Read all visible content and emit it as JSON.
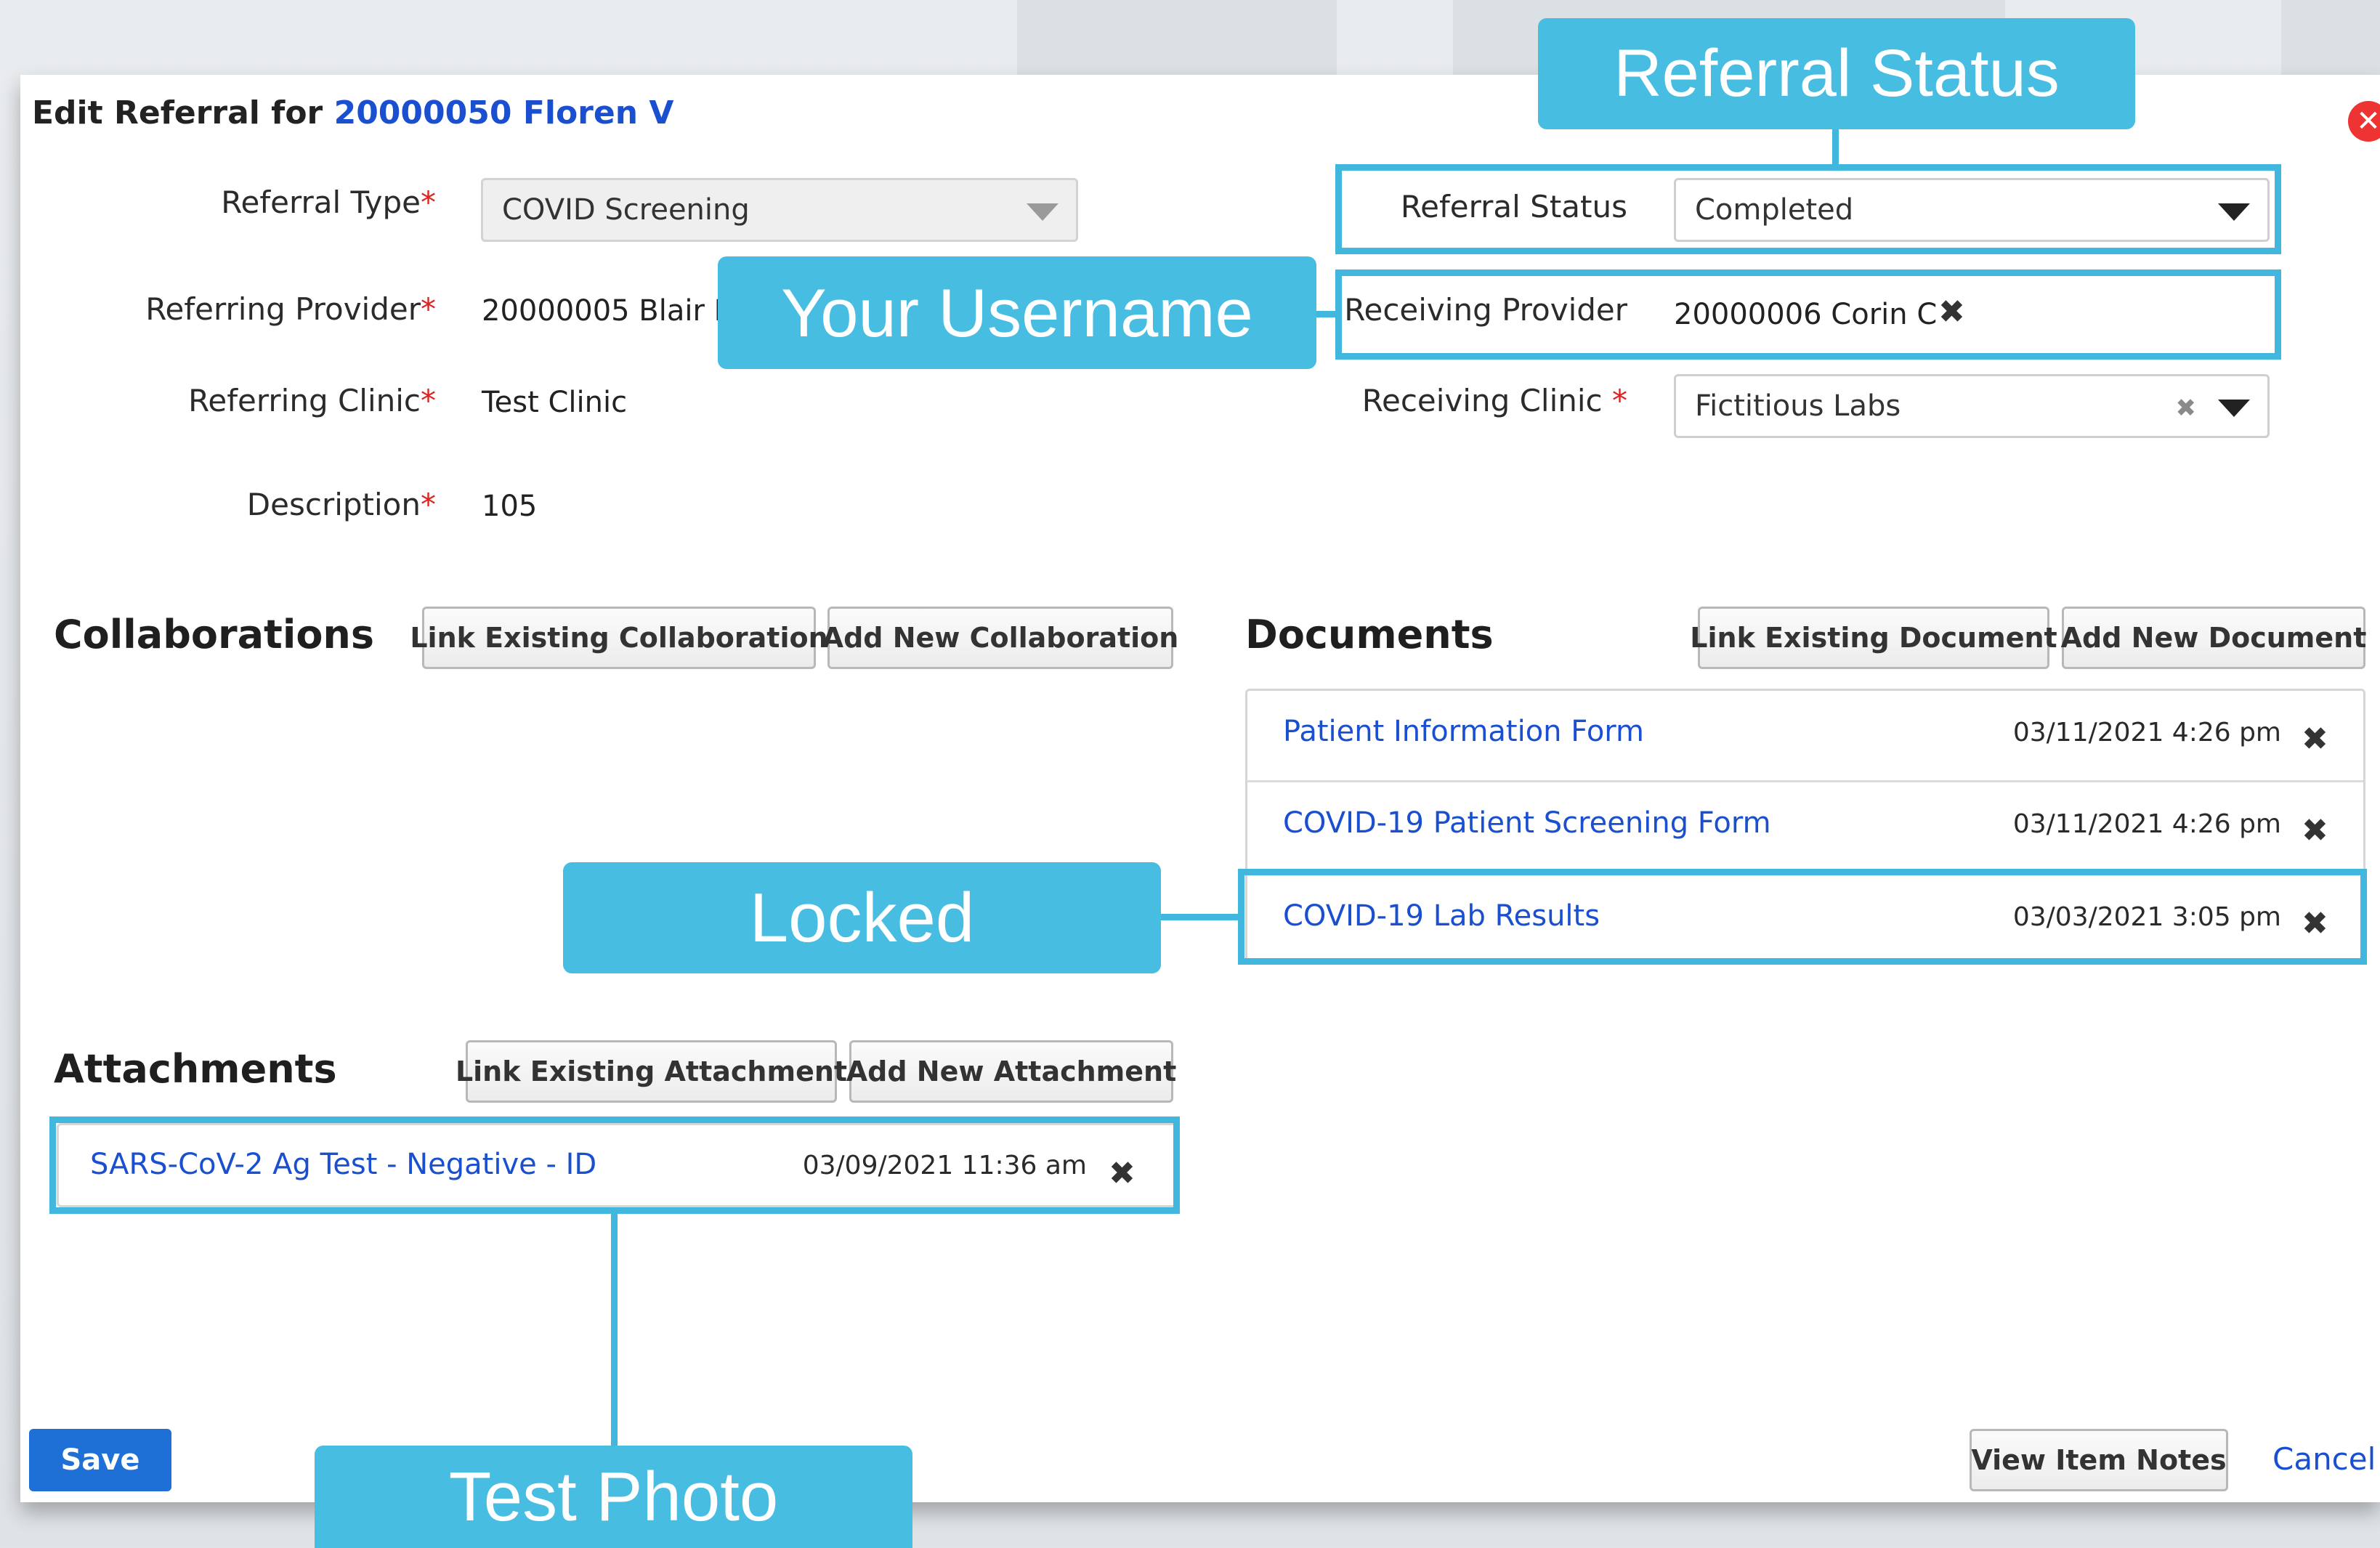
{
  "header": {
    "title_prefix": "Edit Referral for ",
    "patient_link": "20000050 Floren V"
  },
  "form": {
    "referral_type_label": "Referral Type",
    "referral_type_value": "COVID Screening",
    "referring_provider_label": "Referring Provider",
    "referring_provider_value": "20000005 Blair D",
    "referring_clinic_label": "Referring Clinic",
    "referring_clinic_value": "Test Clinic",
    "description_label": "Description",
    "description_value": "105",
    "referral_status_label": "Referral Status",
    "referral_status_value": "Completed",
    "receiving_provider_label": "Receiving Provider",
    "receiving_provider_value": "20000006 Corin C",
    "receiving_clinic_label": "Receiving Clinic",
    "receiving_clinic_value": "Fictitious Labs",
    "required_mark": "*"
  },
  "collaborations": {
    "heading": "Collaborations",
    "link_existing": "Link Existing Collaboration",
    "add_new": "Add New Collaboration"
  },
  "documents": {
    "heading": "Documents",
    "link_existing": "Link Existing Document",
    "add_new": "Add New Document",
    "items": [
      {
        "name": "Patient Information Form",
        "date": "03/11/2021 4:26 pm"
      },
      {
        "name": "COVID-19 Patient Screening Form",
        "date": "03/11/2021 4:26 pm"
      },
      {
        "name": "COVID-19 Lab Results",
        "date": "03/03/2021 3:05 pm"
      }
    ]
  },
  "attachments": {
    "heading": "Attachments",
    "link_existing": "Link Existing Attachment",
    "add_new": "Add New Attachment",
    "items": [
      {
        "name": "SARS-CoV-2 Ag Test - Negative - ID",
        "date": "03/09/2021 11:36 am"
      }
    ]
  },
  "footer": {
    "save": "Save",
    "view_notes": "View Item Notes",
    "cancel": "Cancel"
  },
  "annotations": {
    "referral_status": "Referral Status",
    "username": "Your Username",
    "locked": "Locked",
    "test_photo": "Test Photo"
  },
  "icons": {
    "remove": "✖",
    "clear": "✖",
    "close": "✕"
  },
  "colors": {
    "link": "#1a4fd0",
    "callout": "#47bde2",
    "save_button": "#1e6fd6",
    "required": "#e02020",
    "close_button": "#e33333"
  }
}
